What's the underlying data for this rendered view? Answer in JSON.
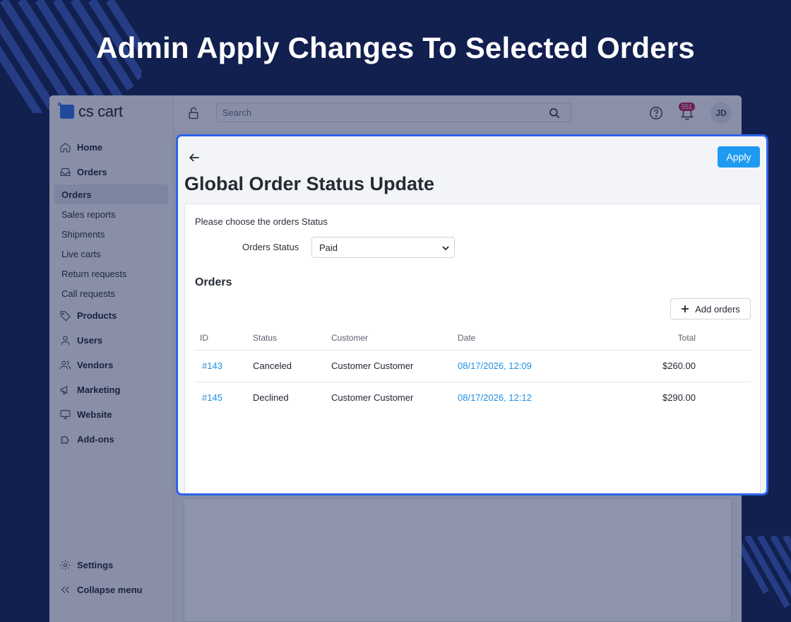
{
  "banner": {
    "title": "Admin Apply Changes To Selected Orders"
  },
  "app": {
    "logo_text": "cs cart",
    "search_placeholder": "Search",
    "notification_count": "551",
    "avatar_initials": "JD"
  },
  "sidebar": {
    "items": [
      {
        "label": "Home",
        "icon": "home-icon"
      },
      {
        "label": "Orders",
        "icon": "inbox-icon"
      },
      {
        "label": "Products",
        "icon": "tag-icon"
      },
      {
        "label": "Users",
        "icon": "user-icon"
      },
      {
        "label": "Vendors",
        "icon": "users-icon"
      },
      {
        "label": "Marketing",
        "icon": "megaphone-icon"
      },
      {
        "label": "Website",
        "icon": "monitor-icon"
      },
      {
        "label": "Add-ons",
        "icon": "puzzle-icon"
      }
    ],
    "sub_items": [
      "Orders",
      "Sales reports",
      "Shipments",
      "Live carts",
      "Return requests",
      "Call requests"
    ],
    "settings": "Settings",
    "collapse": "Collapse menu"
  },
  "panel": {
    "apply_label": "Apply",
    "title": "Global Order Status Update",
    "prompt": "Please choose the orders Status",
    "status_label": "Orders Status",
    "status_value": "Paid",
    "orders_heading": "Orders",
    "add_orders_label": "Add orders",
    "columns": [
      "ID",
      "Status",
      "Customer",
      "Date",
      "Total"
    ],
    "rows": [
      {
        "id": "#143",
        "status": "Canceled",
        "customer": "Customer Customer",
        "date": "08/17/2026, 12:09",
        "total": "$260.00"
      },
      {
        "id": "#145",
        "status": "Declined",
        "customer": "Customer Customer",
        "date": "08/17/2026, 12:12",
        "total": "$290.00"
      }
    ]
  },
  "colors": {
    "background": "#122050",
    "highlight_border": "#2c64e8",
    "apply_button": "#1e9bf0",
    "link": "#1e8fe0"
  }
}
